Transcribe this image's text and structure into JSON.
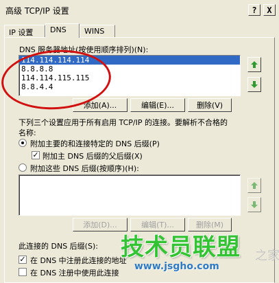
{
  "window": {
    "title": "高级 TCP/IP 设置",
    "help_label": "?",
    "close_label": "X"
  },
  "tabs": [
    {
      "label": "IP 设置"
    },
    {
      "label": "DNS"
    },
    {
      "label": "WINS"
    }
  ],
  "dns": {
    "list_label": "DNS 服务器地址(按使用顺序排列)(N):",
    "servers": [
      "114.114.114.114",
      "8.8.8.8",
      "114.114.115.115",
      "8.8.4.4"
    ],
    "add_label": "添加(A)...",
    "edit_label": "编辑(E)...",
    "remove_label": "删除(V)",
    "info_text_line1": "下列三个设置应用于所有启用 TCP/IP 的连接。要解析不合格的",
    "info_text_line2": "名称:",
    "radio_primary_label": "附加主要的和连接特定的 DNS 后缀(P)",
    "check_parent_label": "附加主 DNS 后缀的父后缀(X)",
    "radio_these_label": "附加这些 DNS 后缀(按顺序)(H):",
    "suffix_add_label": "添加(D)...",
    "suffix_edit_label": "编辑(T)...",
    "suffix_remove_label": "删除(M)",
    "conn_suffix_label": "此连接的 DNS 后缀(S):",
    "register_label": "在 DNS 中注册此连接的地址",
    "use_suffix_label": "在 DNS 注册中使用此连接"
  },
  "watermark": {
    "logo_text": "技术员联盟",
    "url": "www.jsgho.com",
    "side_text": "之家"
  },
  "colors": {
    "selection": "#316ac5",
    "annotation": "#d11010",
    "arrow_green": "#2f9a2f"
  }
}
